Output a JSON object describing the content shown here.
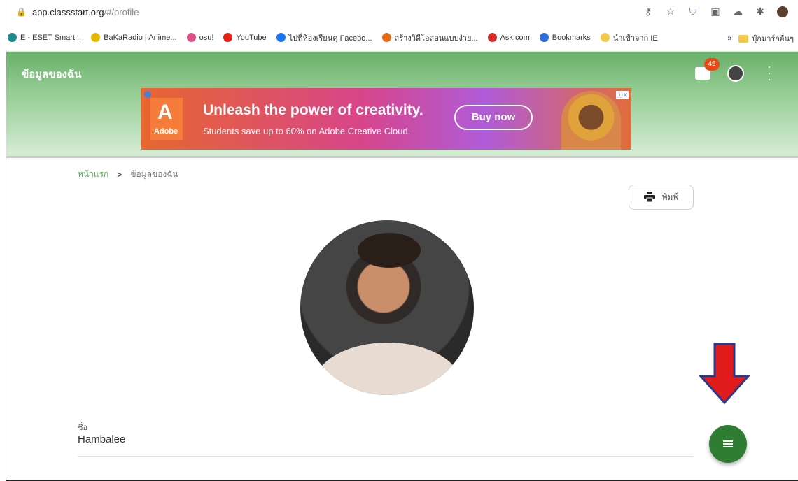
{
  "browser": {
    "url_host": "app.classstart.org",
    "url_path": "/#/profile",
    "bookmarks": [
      {
        "label": "E - ESET Smart...",
        "color": "#1c8a8a"
      },
      {
        "label": "BaKaRadio | Anime...",
        "color": "#e6b800"
      },
      {
        "label": "osu!",
        "color": "#e0508a"
      },
      {
        "label": "YouTube",
        "color": "#e62117"
      },
      {
        "label": "ไปที่ห้องเรียนคุ Facebo...",
        "color": "#1877f2"
      },
      {
        "label": "สร้างวิดีโอสอนแบบง่าย...",
        "color": "#e56a12"
      },
      {
        "label": "Ask.com",
        "color": "#d52b2b"
      },
      {
        "label": "Bookmarks",
        "color": "#2c6fd6"
      },
      {
        "label": "นำเข้าจาก IE",
        "color": "#f2c94c"
      }
    ],
    "bookmarks_more": "»",
    "other_bookmarks": "บุ๊กมาร์กอื่นๆ"
  },
  "app": {
    "title": "ข้อมูลของฉัน",
    "notification_count": "46"
  },
  "ad": {
    "brand": "Adobe",
    "headline": "Unleash the power of creativity.",
    "subline": "Students save up to 60% on Adobe Creative Cloud.",
    "cta": "Buy now"
  },
  "breadcrumb": {
    "home": "หน้าแรก",
    "separator": ">",
    "current": "ข้อมูลของฉัน"
  },
  "print": {
    "label": "พิมพ์"
  },
  "profile": {
    "name_label": "ชื่อ",
    "name_value": "Hambalee"
  },
  "colors": {
    "header_green": "#6ab06a",
    "fab_green": "#2e7d32",
    "arrow_red": "#e01b1b",
    "badge": "#e64a19"
  }
}
